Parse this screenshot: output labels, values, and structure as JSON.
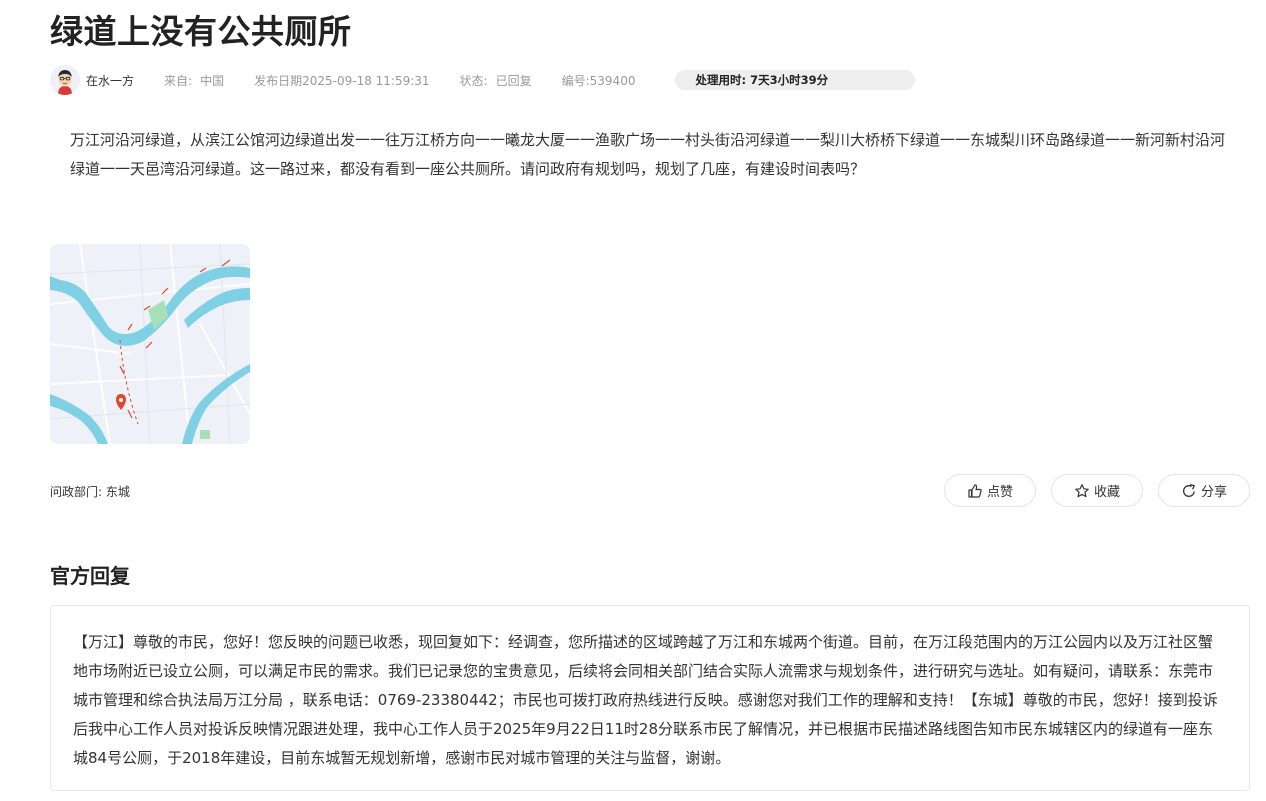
{
  "post": {
    "title": "绿道上没有公共厕所",
    "author": "在水一方",
    "source_label": "来自:",
    "source_value": "中国",
    "date_label": "发布日期",
    "date_value": "2025-09-18 11:59:31",
    "status_label": "状态:",
    "status_value": "已回复",
    "id_label": "编号:",
    "id_value": "539400",
    "processing_time": "处理用时: 7天3小时39分",
    "content": "万江河沿河绿道，从滨江公馆河边绿道出发一一往万江桥方向一一曦龙大厦一一渔歌广场一一村头街沿河绿道一一梨川大桥桥下绿道一一东城梨川环岛路绿道一一新河新村沿河绿道一一天邑湾沿河绿道。这一路过来，都没有看到一座公共厕所。请问政府有规划吗，规划了几座，有建设时间表吗？",
    "department": "问政部门: 东城",
    "map_colors": {
      "river": "#7fcfe5",
      "land": "#eef1f8",
      "park": "#a7dfb6",
      "route": "#e2472c"
    }
  },
  "actions": {
    "like": "点赞",
    "favorite": "收藏",
    "share": "分享"
  },
  "reply": {
    "section_title": "官方回复",
    "text": "【万江】尊敬的市民，您好！您反映的问题已收悉，现回复如下：经调查，您所描述的区域跨越了万江和东城两个街道。目前，在万江段范围内的万江公园内以及万江社区蟹地市场附近已设立公厕，可以满足市民的需求。我们已记录您的宝贵意见，后续将会同相关部门结合实际人流需求与规划条件，进行研究与选址。如有疑问，请联系：东莞市城市管理和综合执法局万江分局 ，联系电话：0769-23380442；市民也可拨打政府热线进行反映。感谢您对我们工作的理解和支持！【东城】尊敬的市民，您好！接到投诉后我中心工作人员对投诉反映情况跟进处理，我中心工作人员于2025年9月22日11时28分联系市民了解情况，并已根据市民描述路线图告知市民东城辖区内的绿道有一座东城84号公厕，于2018年建设，目前东城暂无规划新增，感谢市民对城市管理的关注与监督，谢谢。"
  }
}
